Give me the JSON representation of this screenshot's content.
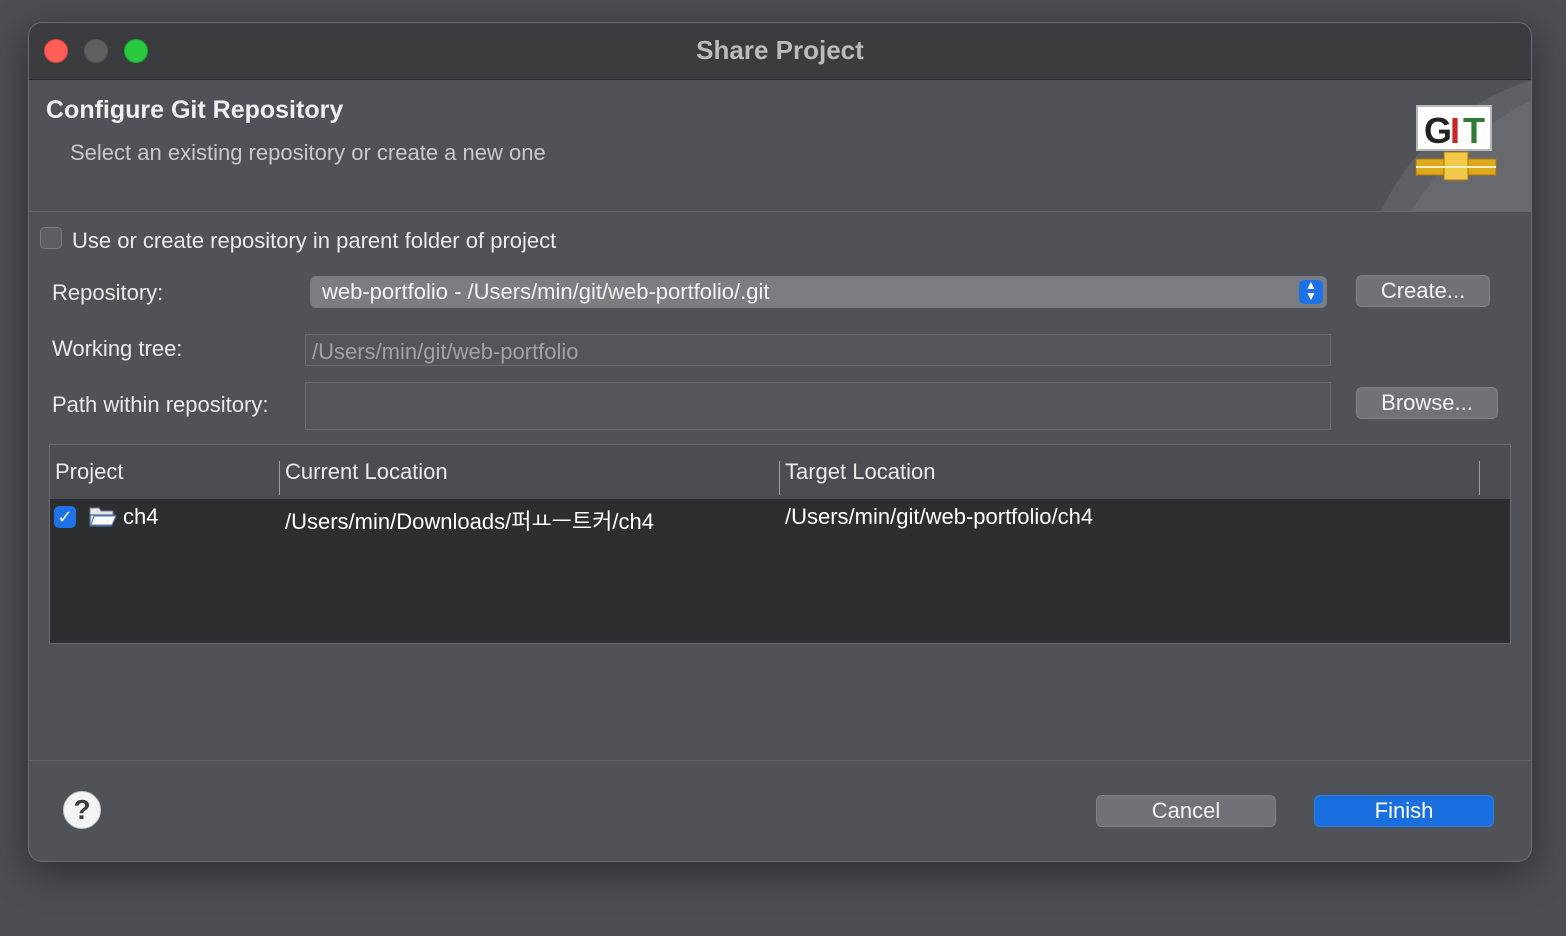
{
  "window": {
    "title": "Share Project"
  },
  "banner": {
    "title": "Configure Git Repository",
    "subtitle": "Select an existing repository or create a new one",
    "logo_text": "GIT"
  },
  "form": {
    "parent_folder_checkbox": {
      "label": "Use or create repository in parent folder of project",
      "checked": false
    },
    "repository": {
      "label": "Repository:",
      "selected_value": "web-portfolio - /Users/min/git/web-portfolio/.git",
      "create_label": "Create..."
    },
    "working_tree": {
      "label": "Working tree:",
      "value": "/Users/min/git/web-portfolio"
    },
    "path_within_repo": {
      "label": "Path within repository:",
      "value": "",
      "browse_label": "Browse..."
    }
  },
  "projects_table": {
    "headers": [
      "Project",
      "Current Location",
      "Target Location"
    ],
    "rows": [
      {
        "checked": true,
        "project": "ch4",
        "current_location": "/Users/min/Downloads/퍼ㅛㅡ트커/ch4",
        "target_location": "/Users/min/git/web-portfolio/ch4"
      }
    ]
  },
  "footer": {
    "help_symbol": "?",
    "cancel_label": "Cancel",
    "finish_label": "Finish"
  },
  "colors": {
    "accent": "#1a6fe0",
    "window_bg": "#4f5357",
    "titlebar_bg": "#3a3c3f",
    "close": "#ff5f57",
    "zoom": "#28c840"
  }
}
